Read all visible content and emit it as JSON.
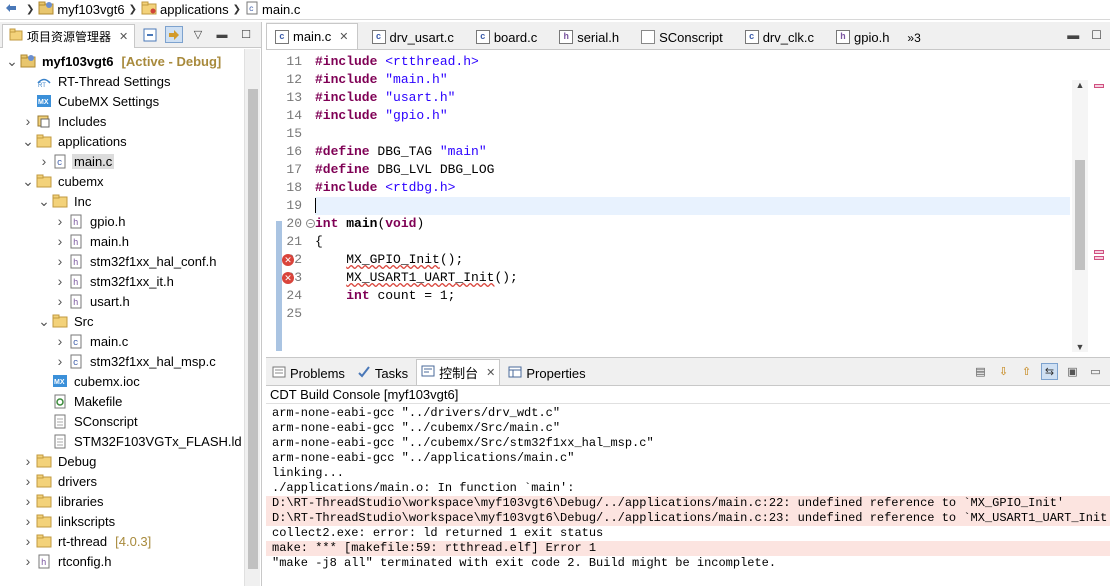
{
  "breadcrumb": [
    {
      "label": "myf103vgt6",
      "icon": "project-icon"
    },
    {
      "label": "applications",
      "icon": "folder-icon"
    },
    {
      "label": "main.c",
      "icon": "c-file-icon"
    }
  ],
  "project_explorer": {
    "tab_label": "项目资源管理器",
    "tree": [
      {
        "label": "myf103vgt6",
        "badge": "[Active - Debug]",
        "icon": "project-icon",
        "depth": 0,
        "toggle": "v",
        "bold": true
      },
      {
        "label": "RT-Thread Settings",
        "icon": "rt-settings-icon",
        "depth": 1,
        "toggle": ""
      },
      {
        "label": "CubeMX Settings",
        "icon": "mx-icon",
        "depth": 1,
        "toggle": ""
      },
      {
        "label": "Includes",
        "icon": "includes-icon",
        "depth": 1,
        "toggle": ">"
      },
      {
        "label": "applications",
        "icon": "folder-icon",
        "depth": 1,
        "toggle": "v"
      },
      {
        "label": "main.c",
        "icon": "c-file-icon",
        "depth": 2,
        "toggle": ">",
        "selected": true
      },
      {
        "label": "cubemx",
        "icon": "folder-icon",
        "depth": 1,
        "toggle": "v"
      },
      {
        "label": "Inc",
        "icon": "folder-icon",
        "depth": 2,
        "toggle": "v"
      },
      {
        "label": "gpio.h",
        "icon": "h-file-icon",
        "depth": 3,
        "toggle": ">"
      },
      {
        "label": "main.h",
        "icon": "h-file-icon",
        "depth": 3,
        "toggle": ">"
      },
      {
        "label": "stm32f1xx_hal_conf.h",
        "icon": "h-file-icon",
        "depth": 3,
        "toggle": ">"
      },
      {
        "label": "stm32f1xx_it.h",
        "icon": "h-file-icon",
        "depth": 3,
        "toggle": ">"
      },
      {
        "label": "usart.h",
        "icon": "h-file-icon",
        "depth": 3,
        "toggle": ">"
      },
      {
        "label": "Src",
        "icon": "folder-icon",
        "depth": 2,
        "toggle": "v"
      },
      {
        "label": "main.c",
        "icon": "c-file-icon",
        "depth": 3,
        "toggle": ">"
      },
      {
        "label": "stm32f1xx_hal_msp.c",
        "icon": "c-file-icon",
        "depth": 3,
        "toggle": ">"
      },
      {
        "label": "cubemx.ioc",
        "icon": "mx-icon",
        "depth": 2,
        "toggle": ""
      },
      {
        "label": "Makefile",
        "icon": "makefile-icon",
        "depth": 2,
        "toggle": ""
      },
      {
        "label": "SConscript",
        "icon": "text-file-icon",
        "depth": 2,
        "toggle": ""
      },
      {
        "label": "STM32F103VGTx_FLASH.ld",
        "icon": "text-file-icon",
        "depth": 2,
        "toggle": ""
      },
      {
        "label": "Debug",
        "icon": "folder-icon",
        "depth": 1,
        "toggle": ">"
      },
      {
        "label": "drivers",
        "icon": "folder-icon",
        "depth": 1,
        "toggle": ">"
      },
      {
        "label": "libraries",
        "icon": "folder-icon",
        "depth": 1,
        "toggle": ">"
      },
      {
        "label": "linkscripts",
        "icon": "folder-icon",
        "depth": 1,
        "toggle": ">"
      },
      {
        "label": "rt-thread",
        "badge": "[4.0.3]",
        "icon": "folder-icon",
        "depth": 1,
        "toggle": ">"
      },
      {
        "label": "rtconfig.h",
        "icon": "h-file-icon",
        "depth": 1,
        "toggle": ">"
      }
    ]
  },
  "editor": {
    "tabs": [
      {
        "label": "main.c",
        "kind": "c",
        "active": true
      },
      {
        "label": "drv_usart.c",
        "kind": "c"
      },
      {
        "label": "board.c",
        "kind": "c"
      },
      {
        "label": "serial.h",
        "kind": "h"
      },
      {
        "label": "SConscript",
        "kind": "s"
      },
      {
        "label": "drv_clk.c",
        "kind": "c"
      },
      {
        "label": "gpio.h",
        "kind": "h"
      }
    ],
    "overflow_count": "»3",
    "lines": [
      {
        "n": "11",
        "tokens": [
          {
            "t": "#include ",
            "c": "kw"
          },
          {
            "t": "<rtthread.h>",
            "c": "str"
          }
        ]
      },
      {
        "n": "12",
        "tokens": [
          {
            "t": "#include ",
            "c": "kw"
          },
          {
            "t": "\"main.h\"",
            "c": "str"
          }
        ]
      },
      {
        "n": "13",
        "tokens": [
          {
            "t": "#include ",
            "c": "kw"
          },
          {
            "t": "\"usart.h\"",
            "c": "str"
          }
        ]
      },
      {
        "n": "14",
        "tokens": [
          {
            "t": "#include ",
            "c": "kw"
          },
          {
            "t": "\"gpio.h\"",
            "c": "str"
          }
        ]
      },
      {
        "n": "15",
        "tokens": []
      },
      {
        "n": "16",
        "tokens": [
          {
            "t": "#define ",
            "c": "kw"
          },
          {
            "t": "DBG_TAG ",
            "c": ""
          },
          {
            "t": "\"main\"",
            "c": "str"
          }
        ]
      },
      {
        "n": "17",
        "tokens": [
          {
            "t": "#define ",
            "c": "kw"
          },
          {
            "t": "DBG_LVL DBG_LOG",
            "c": ""
          }
        ]
      },
      {
        "n": "18",
        "tokens": [
          {
            "t": "#include ",
            "c": "kw"
          },
          {
            "t": "<rtdbg.h>",
            "c": "str"
          }
        ]
      },
      {
        "n": "19",
        "tokens": [],
        "current": true
      },
      {
        "n": "20",
        "tokens": [
          {
            "t": "int ",
            "c": "kw"
          },
          {
            "t": "main",
            "c": "bold"
          },
          {
            "t": "(",
            "c": ""
          },
          {
            "t": "void",
            "c": "kw"
          },
          {
            "t": ")",
            "c": ""
          }
        ],
        "fold": true
      },
      {
        "n": "21",
        "tokens": [
          {
            "t": "{",
            "c": ""
          }
        ]
      },
      {
        "n": "22",
        "tokens": [
          {
            "t": "    ",
            "c": ""
          },
          {
            "t": "MX_GPIO_Init",
            "c": "err"
          },
          {
            "t": "();",
            "c": ""
          }
        ],
        "error": true
      },
      {
        "n": "23",
        "tokens": [
          {
            "t": "    ",
            "c": ""
          },
          {
            "t": "MX_USART1_UART_Init",
            "c": "err"
          },
          {
            "t": "();",
            "c": ""
          }
        ],
        "error": true
      },
      {
        "n": "24",
        "tokens": [
          {
            "t": "    ",
            "c": ""
          },
          {
            "t": "int ",
            "c": "kw"
          },
          {
            "t": "count = 1;",
            "c": ""
          }
        ]
      },
      {
        "n": "25",
        "tokens": []
      }
    ]
  },
  "console": {
    "tabs": [
      {
        "label": "Problems",
        "icon": "problems-icon"
      },
      {
        "label": "Tasks",
        "icon": "tasks-icon"
      },
      {
        "label": "控制台",
        "icon": "console-icon",
        "active": true
      },
      {
        "label": "Properties",
        "icon": "properties-icon"
      }
    ],
    "title": "CDT Build Console [myf103vgt6]",
    "lines": [
      {
        "text": "arm-none-eabi-gcc \"../drivers/drv_wdt.c\"",
        "kind": "normal"
      },
      {
        "text": "arm-none-eabi-gcc \"../cubemx/Src/main.c\"",
        "kind": "normal"
      },
      {
        "text": "arm-none-eabi-gcc \"../cubemx/Src/stm32f1xx_hal_msp.c\"",
        "kind": "normal"
      },
      {
        "text": "arm-none-eabi-gcc \"../applications/main.c\"",
        "kind": "normal"
      },
      {
        "text": "linking...",
        "kind": "normal"
      },
      {
        "text": "./applications/main.o: In function `main':",
        "kind": "normal"
      },
      {
        "text": "D:\\RT-ThreadStudio\\workspace\\myf103vgt6\\Debug/../applications/main.c:22: undefined reference to `MX_GPIO_Init'",
        "kind": "error"
      },
      {
        "text": "D:\\RT-ThreadStudio\\workspace\\myf103vgt6\\Debug/../applications/main.c:23: undefined reference to `MX_USART1_UART_Init'",
        "kind": "error"
      },
      {
        "text": "collect2.exe: error: ld returned 1 exit status",
        "kind": "normal"
      },
      {
        "text": "make: *** [makefile:59: rtthread.elf] Error 1",
        "kind": "error"
      },
      {
        "text": "\"make -j8 all\" terminated with exit code 2. Build might be incomplete.",
        "kind": "normal"
      }
    ]
  }
}
